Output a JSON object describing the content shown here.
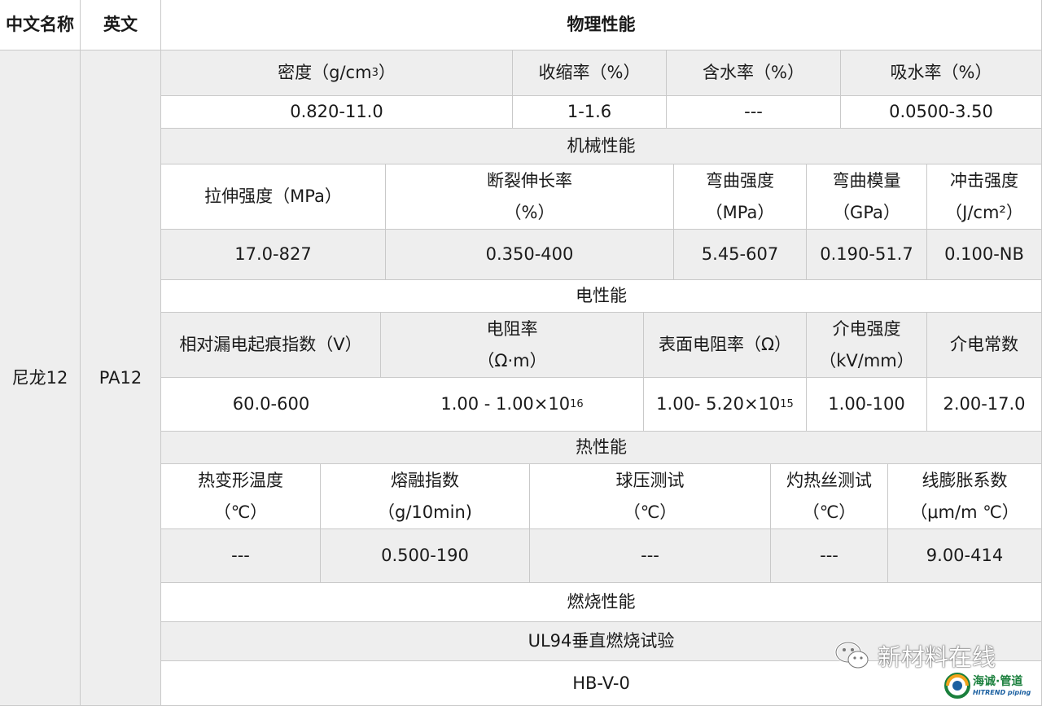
{
  "header": {
    "col1": "中文名称",
    "col2": "英文",
    "col3": "物理性能"
  },
  "material": {
    "cn_name": "尼龙12",
    "en_name": "PA12"
  },
  "physical": {
    "h1": "密度（g/cm",
    "h1_sup": "3",
    "h1_end": "）",
    "h2": "收缩率（%）",
    "h3": "含水率（%）",
    "h4": "吸水率（%）",
    "v1": "0.820-11.0",
    "v2": "1-1.6",
    "v3": "---",
    "v4": "0.0500-3.50"
  },
  "mechanical": {
    "title": "机械性能",
    "h1": "拉伸强度（MPa）",
    "h2a": "断裂伸长率",
    "h2b": "（%）",
    "h3a": "弯曲强度",
    "h3b": "（MPa）",
    "h4a": "弯曲模量",
    "h4b": "（GPa）",
    "h5a": "冲击强度",
    "h5b": "（J/cm²）",
    "v1": "17.0-827",
    "v2": "0.350-400",
    "v3": "5.45-607",
    "v4": "0.190-51.7",
    "v5": "0.100-NB"
  },
  "electrical": {
    "title": "电性能",
    "h1": "相对漏电起痕指数（V）",
    "h2a": "电阻率",
    "h2b": "（Ω·m）",
    "h3": "表面电阻率（Ω）",
    "h4a": "介电强度",
    "h4b": "（kV/mm）",
    "h5": "介电常数",
    "v1": "60.0-600",
    "v2": "1.00 - 1.00×10",
    "v2_sup": "16",
    "v3": "1.00- 5.20×10",
    "v3_sup": "15",
    "v4": "1.00-100",
    "v5": "2.00-17.0"
  },
  "thermal": {
    "title": "热性能",
    "h1a": "热变形温度",
    "h1b": "（℃）",
    "h2a": "熔融指数",
    "h2b": "（g/10min)",
    "h3a": "球压测试",
    "h3b": "（℃）",
    "h4a": "灼热丝测试",
    "h4b": "（℃）",
    "h5a": "线膨胀系数",
    "h5b": "（μm/m ℃）",
    "v1": "---",
    "v2": "0.500-190",
    "v3": "---",
    "v4": "---",
    "v5": "9.00-414"
  },
  "combustion": {
    "title": "燃烧性能",
    "test": "UL94垂直燃烧试验",
    "value": "HB-V-0"
  },
  "watermark": {
    "text": "新材料在线",
    "logo_cn": "海诚·管道",
    "logo_en": "HITREND piping"
  }
}
